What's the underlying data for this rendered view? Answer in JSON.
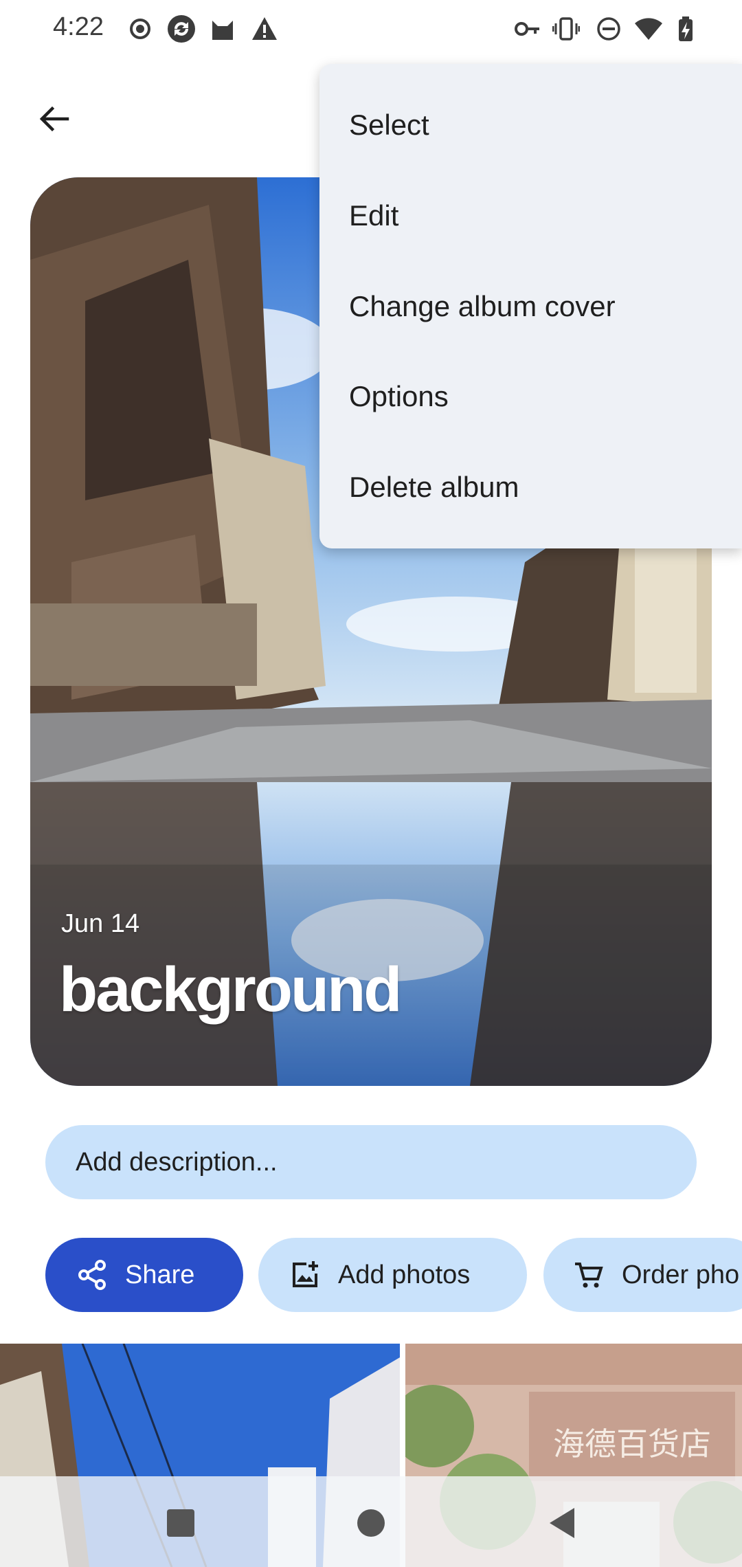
{
  "status_bar": {
    "time": "4:22",
    "left_icons": [
      "record-icon",
      "sync-icon",
      "cat-icon",
      "alert-icon"
    ],
    "right_icons": [
      "key-icon",
      "vibrate-icon",
      "dnd-icon",
      "wifi-icon",
      "battery-charging-icon"
    ]
  },
  "top_bar": {
    "back_icon": "arrow-back-icon"
  },
  "album": {
    "date": "Jun 14",
    "title": "background",
    "description_placeholder": "Add description..."
  },
  "actions": {
    "share_label": "Share",
    "add_photos_label": "Add photos",
    "order_label": "Order pho"
  },
  "menu": {
    "items": [
      "Select",
      "Edit",
      "Change album cover",
      "Options",
      "Delete album"
    ]
  },
  "nav": {
    "recents_icon": "square-icon",
    "home_icon": "circle-icon",
    "back_icon": "triangle-back-icon"
  },
  "thumbnail_texts": {
    "store_sign": "海德百货店"
  },
  "colors": {
    "primary": "#2a4fc9",
    "chip_bg": "#c9e2fb",
    "menu_bg": "#eef1f6"
  }
}
